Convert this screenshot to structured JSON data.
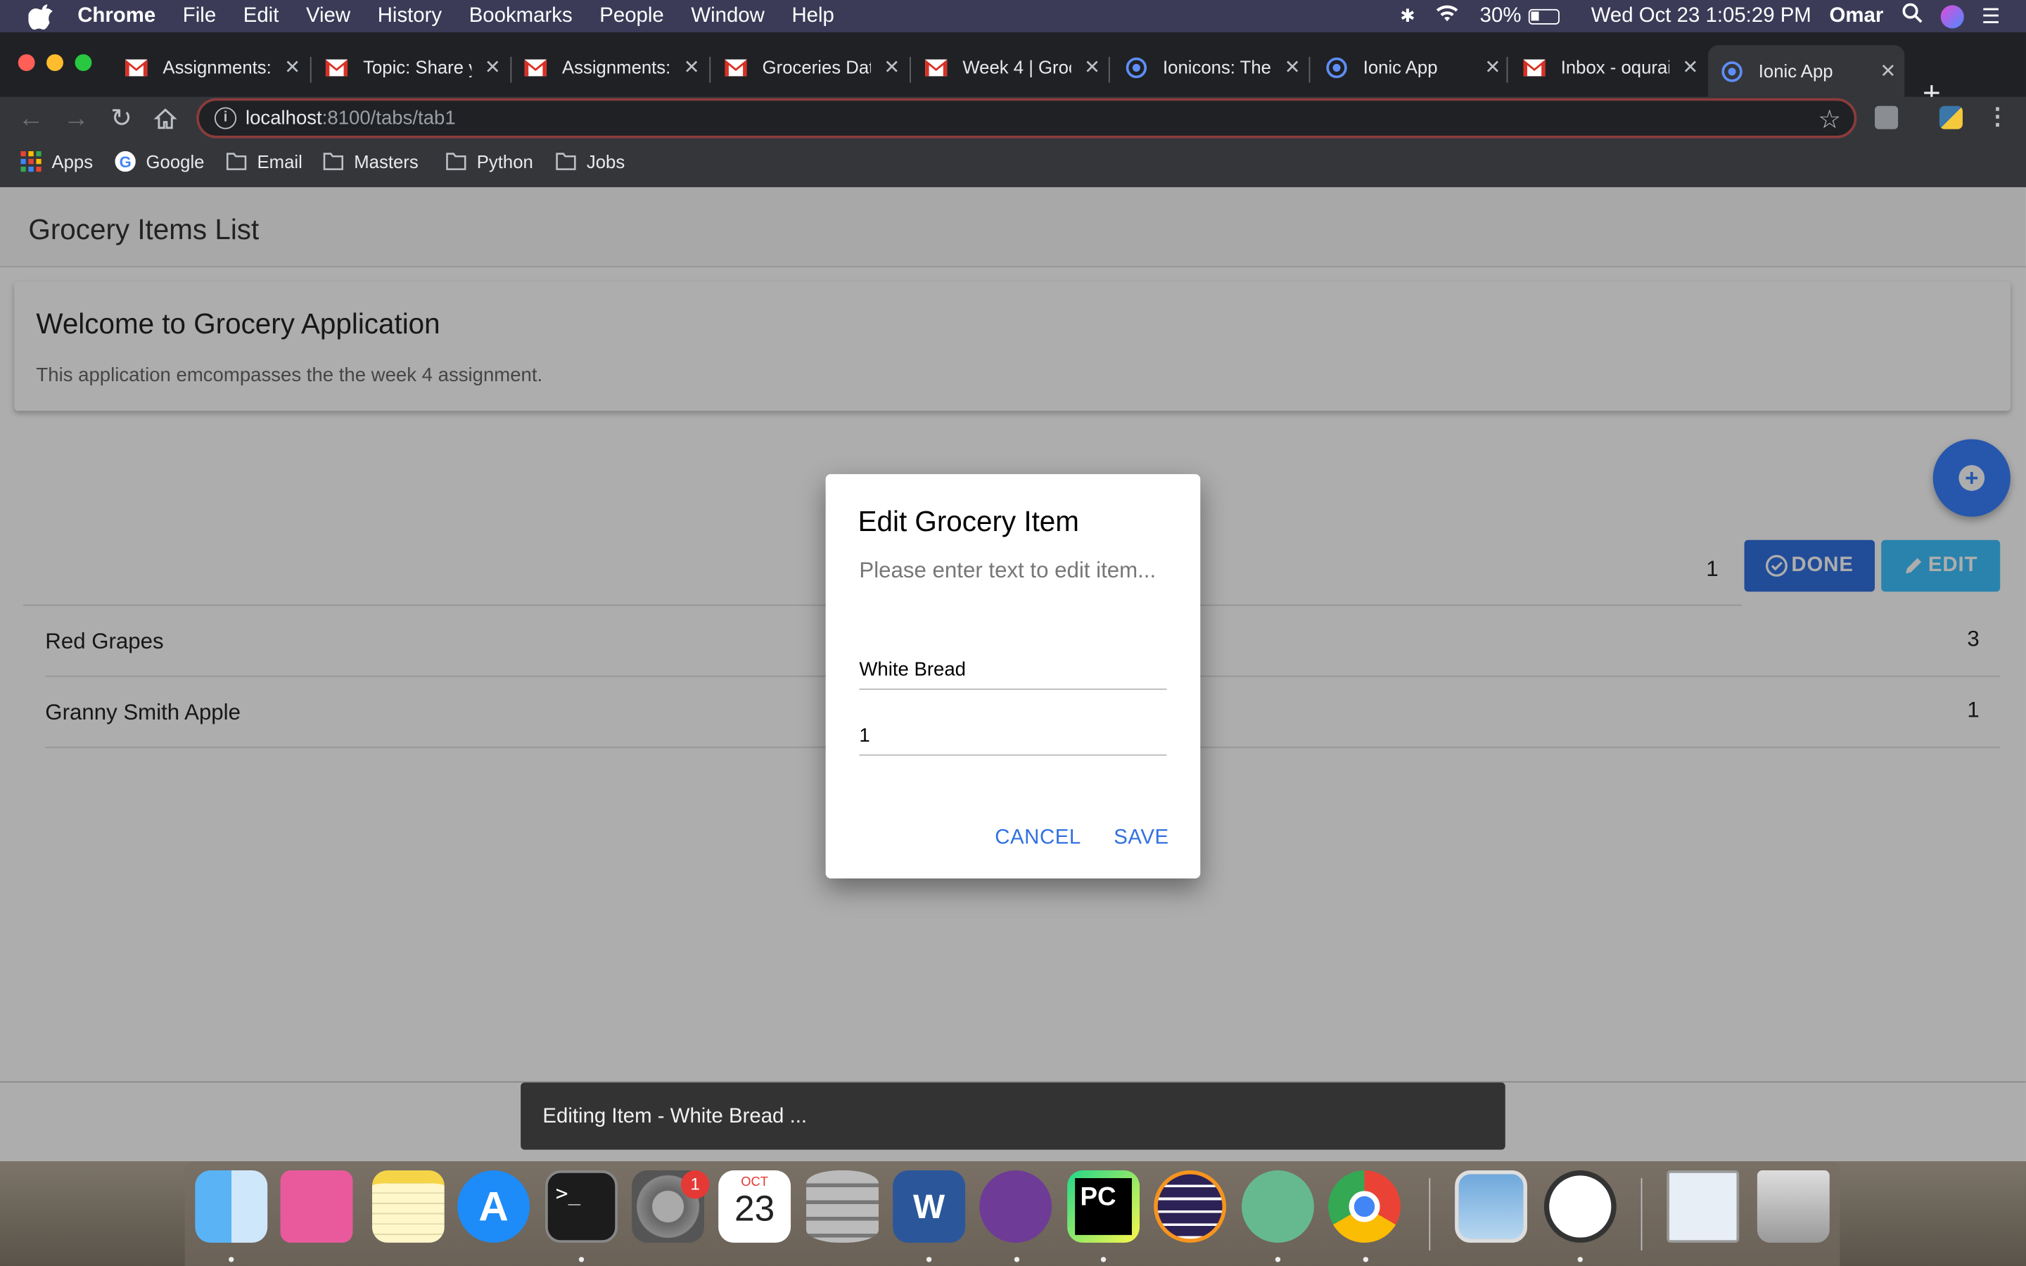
{
  "menubar": {
    "app_name": "Chrome",
    "items": [
      "File",
      "Edit",
      "View",
      "History",
      "Bookmarks",
      "People",
      "Window",
      "Help"
    ],
    "battery": "30%",
    "datetime": "Wed Oct 23  1:05:29 PM",
    "user": "Omar"
  },
  "tabs": [
    {
      "label": "Assignments:",
      "icon": "gmail-icon"
    },
    {
      "label": "Topic: Share y",
      "icon": "gmail-icon"
    },
    {
      "label": "Assignments:",
      "icon": "gmail-icon"
    },
    {
      "label": "Groceries Data",
      "icon": "gmail-icon"
    },
    {
      "label": "Week 4 | Groc",
      "icon": "gmail-icon"
    },
    {
      "label": "Ionicons: The",
      "icon": "ionic-icon"
    },
    {
      "label": "Ionic App",
      "icon": "ionic-icon"
    },
    {
      "label": "Inbox - oqurai",
      "icon": "gmail-icon"
    },
    {
      "label": "Ionic App",
      "icon": "ionic-icon",
      "active": true
    }
  ],
  "address_bar": {
    "host": "localhost",
    "path": ":8100/tabs/tab1"
  },
  "bookmarks": [
    {
      "label": "Apps",
      "icon": "apps-grid-icon"
    },
    {
      "label": "Google",
      "icon": "google-icon"
    },
    {
      "label": "Email",
      "icon": "folder-icon"
    },
    {
      "label": "Masters",
      "icon": "folder-icon"
    },
    {
      "label": "Python",
      "icon": "folder-icon"
    },
    {
      "label": "Jobs",
      "icon": "folder-icon"
    }
  ],
  "page": {
    "header_title": "Grocery Items List",
    "card_title": "Welcome to Grocery Application",
    "card_body": "This application emcompasses the the week 4 assignment.",
    "first_row_qty": "1",
    "done_label": "DONE",
    "edit_label": "EDIT",
    "items": [
      {
        "name": "Red Grapes",
        "qty": "3"
      },
      {
        "name": "Granny Smith Apple",
        "qty": "1"
      }
    ]
  },
  "dialog": {
    "title": "Edit Grocery Item",
    "message": "Please enter text to edit item...",
    "name_value": "White Bread",
    "qty_value": "1",
    "cancel_label": "CANCEL",
    "save_label": "SAVE"
  },
  "toast": {
    "message": "Editing Item - White Bread ..."
  },
  "dock": {
    "system_prefs_badge": "1",
    "calendar_month": "OCT",
    "calendar_day": "23"
  },
  "colors": {
    "primary": "#3171e0",
    "secondary": "#3dc2ff",
    "fab": "#3880ff"
  }
}
